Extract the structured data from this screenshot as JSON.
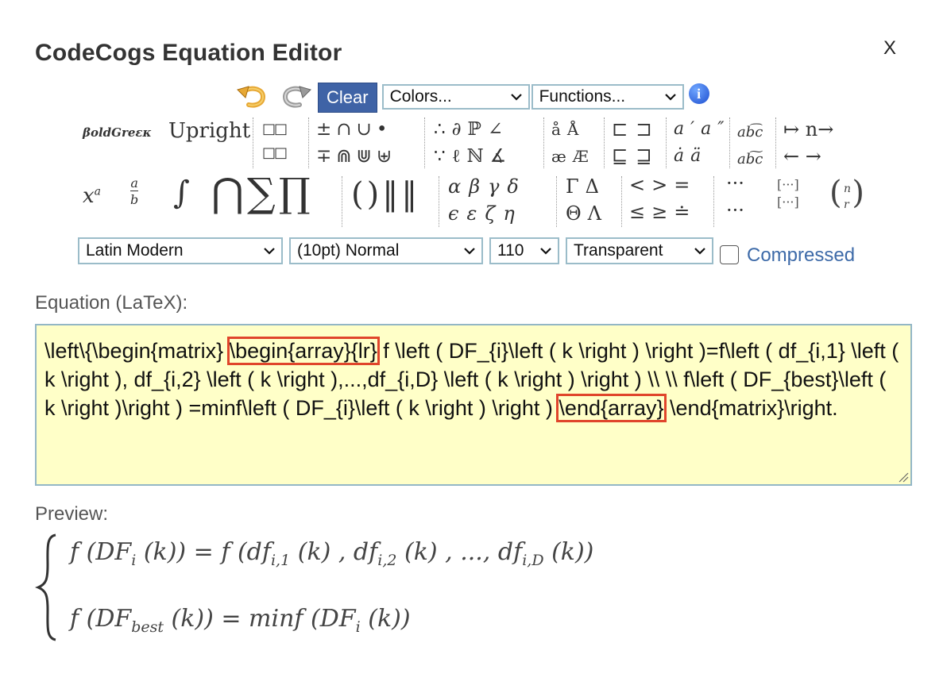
{
  "window": {
    "title": "CodeCogs Equation Editor",
    "close_label": "X"
  },
  "toolbar": {
    "clear_label": "Clear",
    "colors_select": "Colors...",
    "functions_select": "Functions...",
    "font_select": "Latin Modern",
    "size_select": "(10pt) Normal",
    "dpi_select": "110",
    "background_select": "Transparent",
    "compressed_label": "Compressed",
    "compressed_checked": false
  },
  "symbols": {
    "bold_greek": "βoldGreεκ",
    "upright": "Upright",
    "group_arrows_row1": "↦  n→",
    "group_arrows_row2": "←  →"
  },
  "equation": {
    "label": "Equation (LaTeX):",
    "seg1": "\\left\\{\\begin{matrix} ",
    "hl1": "\\begin{array}{lr}",
    "seg2": " f \\left ( DF_{i}\\left ( k \\right ) \\right )=f\\left ( df_{i,1} \\left ( k \\right ), df_{i,2} \\left ( k \\right ),...,df_{i,D} \\left ( k \\right ) \\right ) \\\\ \\\\ f\\left ( DF_{best}\\left ( k \\right )\\right ) =minf\\left ( DF_{i}\\left ( k \\right ) \\right ) ",
    "hl2": "\\end{array}",
    "seg3": " \\end{matrix}\\right."
  },
  "preview": {
    "label": "Preview:"
  },
  "colors": {
    "clear_bg": "#3f63a6",
    "editor_bg": "#ffffc8",
    "highlight": "#e0452b",
    "link": "#3d6aa8"
  }
}
